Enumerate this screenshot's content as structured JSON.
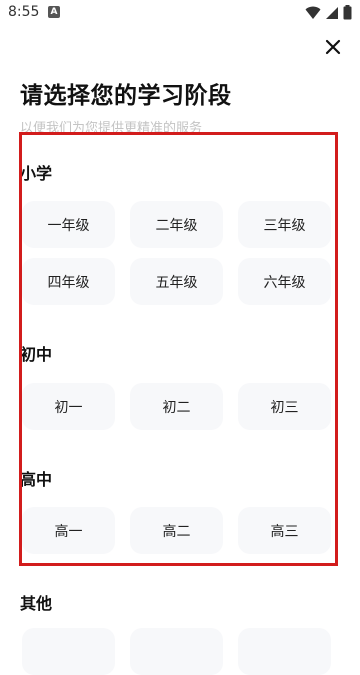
{
  "status_bar": {
    "time": "8:55",
    "notification_badge": "A",
    "icons": [
      "wifi-icon",
      "signal-icon",
      "battery-icon"
    ]
  },
  "header": {
    "close_icon": "close-icon",
    "title": "请选择您的学习阶段",
    "subtitle": "以便我们为您提供更精准的服务"
  },
  "sections": {
    "primary": {
      "title": "小学",
      "grades": [
        "一年级",
        "二年级",
        "三年级",
        "四年级",
        "五年级",
        "六年级"
      ]
    },
    "middle": {
      "title": "初中",
      "grades": [
        "初一",
        "初二",
        "初三"
      ]
    },
    "high": {
      "title": "高中",
      "grades": [
        "高一",
        "高二",
        "高三"
      ]
    },
    "other": {
      "title": "其他"
    }
  },
  "colors": {
    "highlight_border": "#d21c1c",
    "button_background": "#f7f8fa",
    "subtitle_text": "#c4c4c4"
  }
}
